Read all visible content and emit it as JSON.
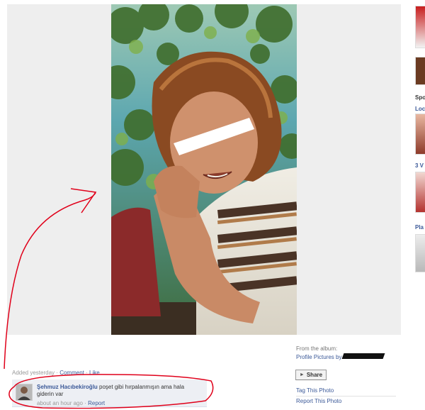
{
  "colors": {
    "stage_background": "#eeeeee",
    "link": "#3b5998",
    "muted": "#999999",
    "comment_background": "#edeff4",
    "annotation": "#e0001a"
  },
  "right_ads": {
    "labels": [
      "Spo",
      "Loc",
      "3 V",
      "Pla"
    ]
  },
  "photo": {
    "alt": ""
  },
  "meta": {
    "added": "Added yesterday",
    "comment_link": "Comment",
    "like_link": "Like",
    "separator": "·"
  },
  "comment": {
    "author": "Şehmuz Hacıbekiroğlu",
    "text": "poşet gibi hırpalanmışın ama hala giderin var",
    "time": "about an hour ago",
    "report_link": "Report",
    "separator": "·"
  },
  "album": {
    "from_label": "From the album:",
    "name": "Profile Pictures by"
  },
  "actions": {
    "share_label": "Share",
    "share_icon": "share-icon",
    "tag_photo": "Tag This Photo",
    "report_photo": "Report This Photo"
  }
}
